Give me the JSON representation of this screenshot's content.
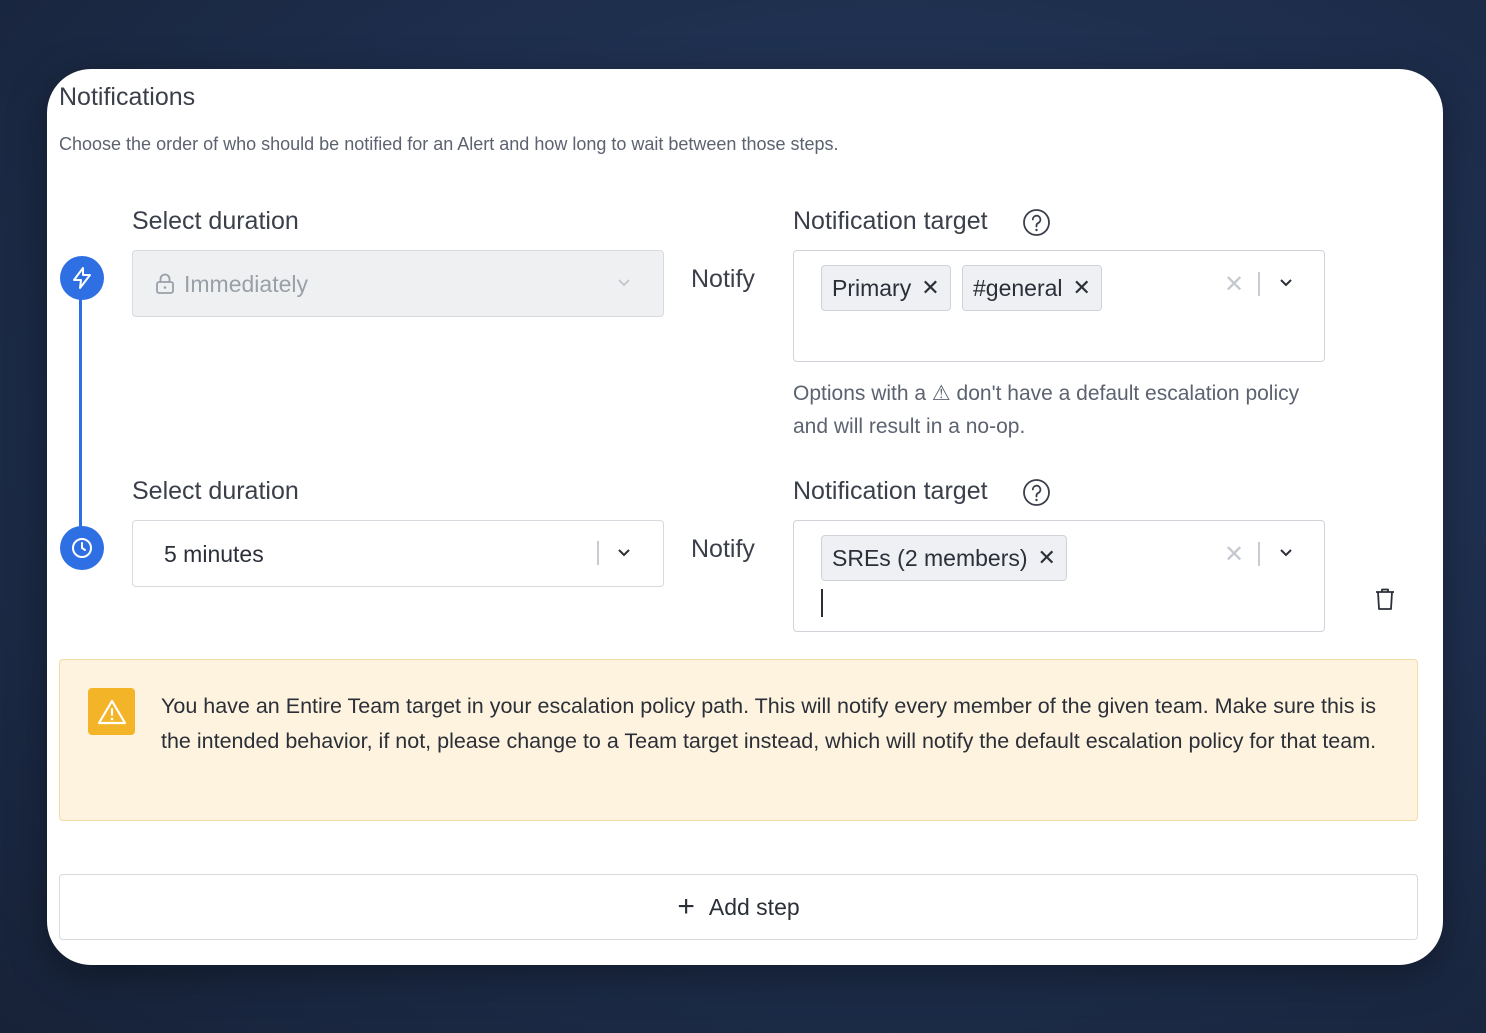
{
  "section": {
    "title": "Notifications",
    "subtitle": "Choose the order of who should be notified for an Alert and how long to wait between those steps."
  },
  "steps": [
    {
      "duration_label": "Select duration",
      "duration_value": "Immediately",
      "duration_locked": true,
      "step_icon": "lightning-icon",
      "notify_label": "Notify",
      "target_label": "Notification target",
      "targets": [
        "Primary",
        "#general"
      ],
      "help_text": "Options with a ⚠ don't have a default escalation policy and will result in a no-op."
    },
    {
      "duration_label": "Select duration",
      "duration_value": "5 minutes",
      "duration_locked": false,
      "step_icon": "clock-icon",
      "notify_label": "Notify",
      "target_label": "Notification target",
      "targets": [
        "SREs (2 members)"
      ]
    }
  ],
  "warning": {
    "icon": "warning-icon",
    "text": "You have an Entire Team target in your escalation policy path. This will notify every member of the given team. Make sure this is the intended behavior, if not, please change to a Team target instead, which will notify the default escalation policy for that team."
  },
  "add_step": {
    "label": "Add step"
  },
  "colors": {
    "accent": "#2f6fe4",
    "warning_bg": "#fdf3df",
    "warning_icon": "#f4b428"
  }
}
